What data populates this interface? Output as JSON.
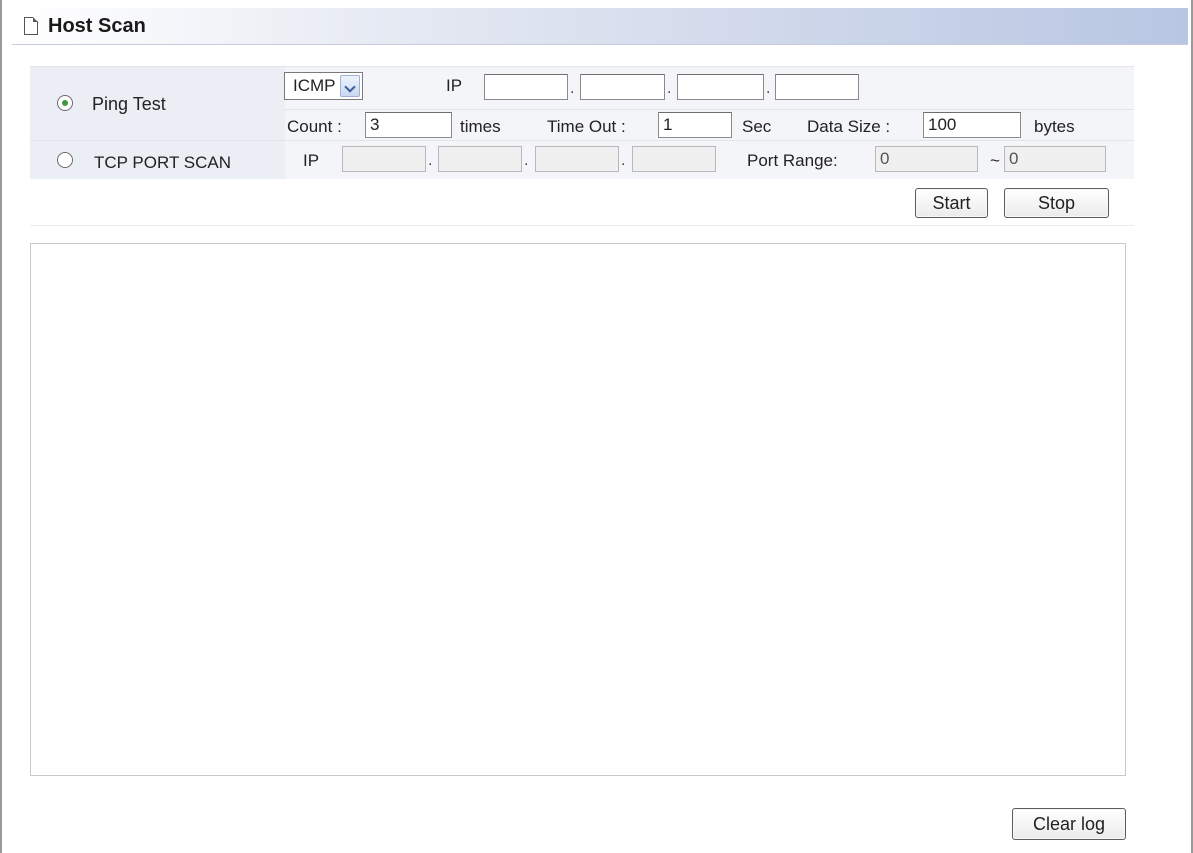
{
  "header": {
    "title": "Host Scan"
  },
  "ping": {
    "label": "Ping Test",
    "selected": true,
    "protocol": "ICMP",
    "ip_label": "IP",
    "ip": [
      "",
      "",
      "",
      ""
    ],
    "count_label": "Count :",
    "count": "3",
    "times_label": "times",
    "timeout_label": "Time Out :",
    "timeout": "1",
    "sec_label": "Sec",
    "datasize_label": "Data Size :",
    "datasize": "100",
    "bytes_label": "bytes"
  },
  "tcp": {
    "label": "TCP PORT SCAN",
    "selected": false,
    "ip_label": "IP",
    "ip": [
      "",
      "",
      "",
      ""
    ],
    "port_range_label": "Port Range:",
    "port_from": "0",
    "tilde": "~",
    "port_to": "0"
  },
  "buttons": {
    "start": "Start",
    "stop": "Stop",
    "clear_log": "Clear log"
  },
  "log": {
    "content": ""
  }
}
